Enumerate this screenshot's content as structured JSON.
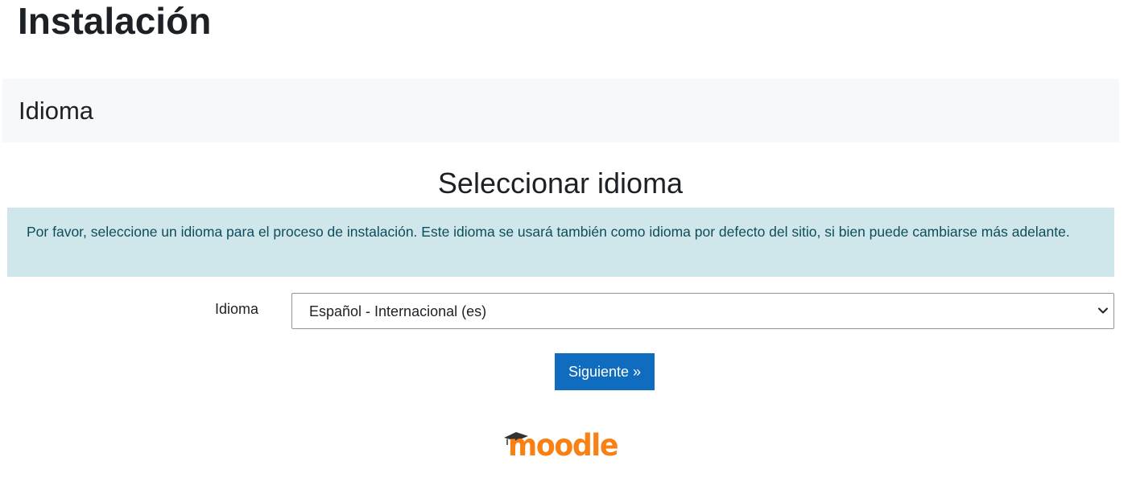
{
  "page": {
    "title": "Instalación"
  },
  "section": {
    "title": "Idioma"
  },
  "content": {
    "heading": "Seleccionar idioma",
    "info_message": "Por favor, seleccione un idioma para el proceso de instalación. Este idioma se usará también como idioma por defecto del sitio, si bien puede cambiarse más adelante."
  },
  "form": {
    "language_label": "Idioma",
    "language_selected": "Español - Internacional (es)",
    "submit_label": "Siguiente »"
  },
  "footer": {
    "logo_text": "moodle",
    "logo_icon": "graduation-cap-icon"
  },
  "colors": {
    "primary_button": "#0f6cbf",
    "info_background": "#cfe7ea",
    "info_text": "#0f4c5c",
    "header_background": "#f7f8fa",
    "logo_orange": "#f98012",
    "logo_cap": "#333333"
  }
}
